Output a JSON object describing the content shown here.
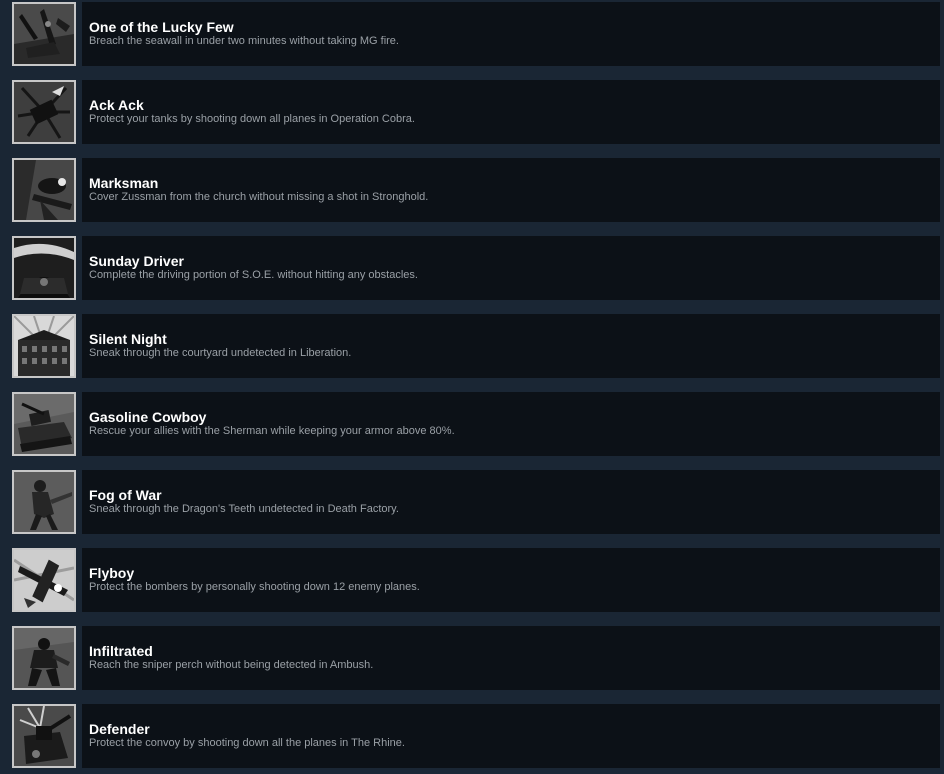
{
  "achievements": [
    {
      "icon": "landing-craft-icon",
      "title": "One of the Lucky Few",
      "description": "Breach the seawall in under two minutes without taking MG fire."
    },
    {
      "icon": "anti-aircraft-icon",
      "title": "Ack Ack",
      "description": "Protect your tanks by shooting down all planes in Operation Cobra."
    },
    {
      "icon": "sniper-icon",
      "title": "Marksman",
      "description": "Cover Zussman from the church without missing a shot in Stronghold."
    },
    {
      "icon": "driver-icon",
      "title": "Sunday Driver",
      "description": "Complete the driving portion of S.O.E. without hitting any obstacles."
    },
    {
      "icon": "building-icon",
      "title": "Silent Night",
      "description": "Sneak through the courtyard undetected in Liberation."
    },
    {
      "icon": "tank-icon",
      "title": "Gasoline Cowboy",
      "description": "Rescue your allies with the Sherman while keeping your armor above 80%."
    },
    {
      "icon": "soldier-icon",
      "title": "Fog of War",
      "description": "Sneak through the Dragon's Teeth undetected in Death Factory."
    },
    {
      "icon": "plane-icon",
      "title": "Flyboy",
      "description": "Protect the bombers by personally shooting down 12 enemy planes."
    },
    {
      "icon": "infiltrator-icon",
      "title": "Infiltrated",
      "description": "Reach the sniper perch without being detected in Ambush."
    },
    {
      "icon": "turret-icon",
      "title": "Defender",
      "description": "Protect the convoy by shooting down all the planes in The Rhine."
    }
  ],
  "colors": {
    "page_background": "#1a2634",
    "row_background": "#0c1117",
    "title": "#ffffff",
    "description": "#9aa0a6",
    "icon_border": "#c7c7c7"
  }
}
